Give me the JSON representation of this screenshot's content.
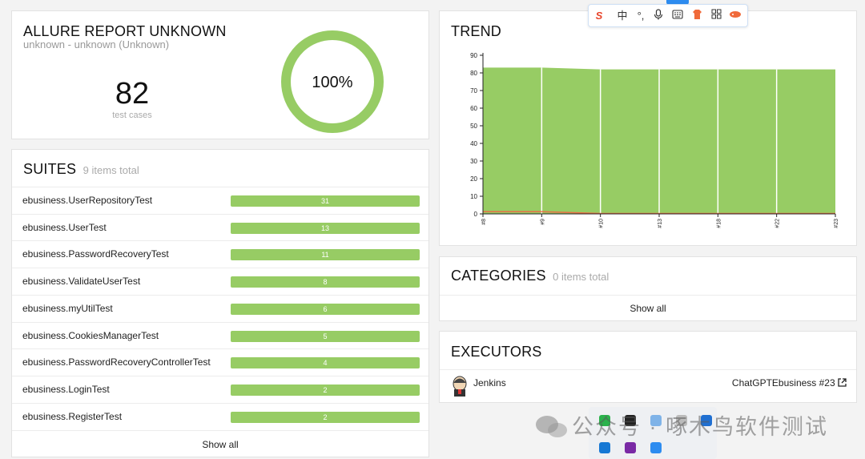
{
  "summary": {
    "title": "ALLURE REPORT UNKNOWN",
    "subtitle": "unknown - unknown (Unknown)",
    "test_cases_count": "82",
    "test_cases_label": "test cases",
    "pass_percent_text": "100%",
    "pass_fraction": 1.0,
    "colors": {
      "passed": "#97cc64"
    }
  },
  "suites": {
    "title": "SUITES",
    "total_text": "9 items total",
    "show_all": "Show all",
    "items": [
      {
        "name": "ebusiness.UserRepositoryTest",
        "count": "31"
      },
      {
        "name": "ebusiness.UserTest",
        "count": "13"
      },
      {
        "name": "ebusiness.PasswordRecoveryTest",
        "count": "11"
      },
      {
        "name": "ebusiness.ValidateUserTest",
        "count": "8"
      },
      {
        "name": "ebusiness.myUtilTest",
        "count": "6"
      },
      {
        "name": "ebusiness.CookiesManagerTest",
        "count": "5"
      },
      {
        "name": "ebusiness.PasswordRecoveryControllerTest",
        "count": "4"
      },
      {
        "name": "ebusiness.LoginTest",
        "count": "2"
      },
      {
        "name": "ebusiness.RegisterTest",
        "count": "2"
      }
    ]
  },
  "trend": {
    "title": "TREND"
  },
  "chart_data": {
    "type": "area",
    "title": "TREND",
    "xlabel": "",
    "ylabel": "",
    "ylim": [
      0,
      90
    ],
    "yticks": [
      0,
      10,
      20,
      30,
      40,
      50,
      60,
      70,
      80,
      90
    ],
    "categories": [
      "#8",
      "#9",
      "#10",
      "#13",
      "#18",
      "#22",
      "#23"
    ],
    "series": [
      {
        "values": [
          83,
          83,
          82,
          82,
          82,
          82,
          82
        ],
        "color": "#97cc64"
      },
      {
        "values": [
          1,
          1,
          0,
          0,
          0,
          0,
          0
        ],
        "color": "#fd5a3e"
      }
    ],
    "grid": false
  },
  "categories": {
    "title": "CATEGORIES",
    "total_text": "0 items total",
    "show_all": "Show all"
  },
  "executors": {
    "title": "EXECUTORS",
    "name": "Jenkins",
    "build": "ChatGPTEbusiness #23",
    "external_icon": "external-link-icon"
  },
  "overlay": {
    "ime_icons": [
      "sogou-logo-icon",
      "chinese-mode-icon",
      "punctuation-icon",
      "microphone-icon",
      "keyboard-icon",
      "skin-icon",
      "toolbox-icon",
      "more-icon"
    ],
    "ime_chinese_label": "中",
    "watermark": "公众号 · 啄木鸟软件测试"
  }
}
